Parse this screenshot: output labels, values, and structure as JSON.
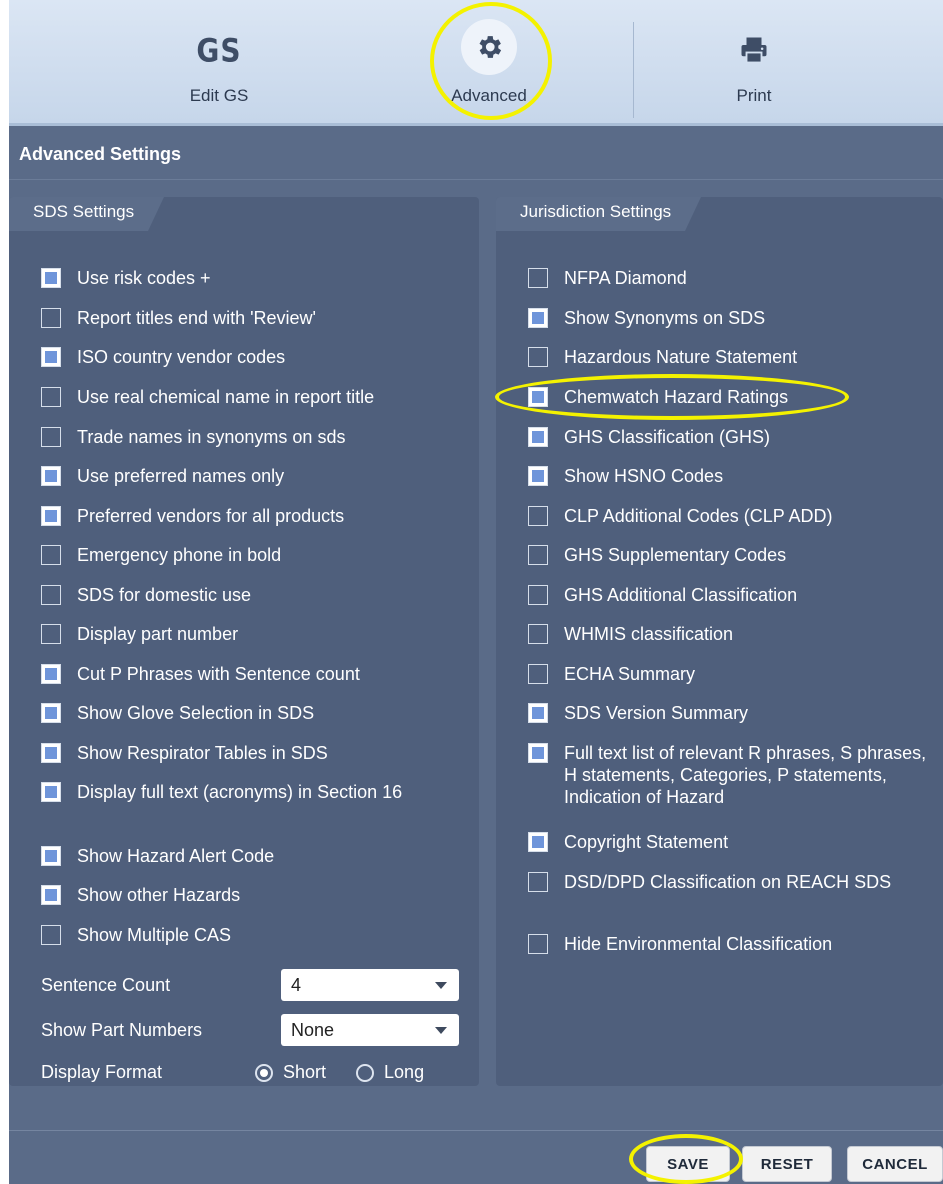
{
  "toolbar": {
    "items": [
      {
        "label": "Edit GS",
        "icon": "gs-logo-icon",
        "logo_text": "GS"
      },
      {
        "label": "Advanced",
        "icon": "gear-icon"
      },
      {
        "label": "Print",
        "icon": "printer-icon"
      }
    ]
  },
  "section_title": "Advanced Settings",
  "sds_settings": {
    "tab_label": "SDS Settings",
    "checkboxes": [
      {
        "label": "Use risk codes +",
        "checked": true
      },
      {
        "label": "Report titles end with 'Review'",
        "checked": false
      },
      {
        "label": "ISO country vendor codes",
        "checked": true
      },
      {
        "label": "Use real chemical name in report title",
        "checked": false
      },
      {
        "label": "Trade names in synonyms on sds",
        "checked": false
      },
      {
        "label": "Use preferred names only",
        "checked": true
      },
      {
        "label": "Preferred vendors for all products",
        "checked": true
      },
      {
        "label": "Emergency phone in bold",
        "checked": false
      },
      {
        "label": "SDS for domestic use",
        "checked": false
      },
      {
        "label": "Display part number",
        "checked": false
      },
      {
        "label": "Cut P Phrases with Sentence count",
        "checked": true
      },
      {
        "label": "Show Glove Selection in SDS",
        "checked": true
      },
      {
        "label": "Show Respirator Tables in SDS",
        "checked": true
      },
      {
        "label": "Display full text (acronyms) in Section 16",
        "checked": true
      },
      {
        "label": "Show Hazard Alert Code",
        "checked": true
      },
      {
        "label": "Show other Hazards",
        "checked": true
      },
      {
        "label": "Show Multiple CAS",
        "checked": false
      }
    ],
    "sentence_count": {
      "label": "Sentence Count",
      "value": "4"
    },
    "show_part_numbers": {
      "label": "Show Part Numbers",
      "value": "None"
    },
    "display_format": {
      "label": "Display Format",
      "options": [
        "Short",
        "Long"
      ],
      "selected": "Short"
    }
  },
  "jurisdiction_settings": {
    "tab_label": "Jurisdiction Settings",
    "checkboxes": [
      {
        "label": "NFPA Diamond",
        "checked": false
      },
      {
        "label": "Show Synonyms on SDS",
        "checked": true
      },
      {
        "label": "Hazardous Nature Statement",
        "checked": false
      },
      {
        "label": "Chemwatch Hazard Ratings",
        "checked": true
      },
      {
        "label": "GHS Classification (GHS)",
        "checked": true
      },
      {
        "label": "Show HSNO Codes",
        "checked": true
      },
      {
        "label": "CLP Additional Codes (CLP ADD)",
        "checked": false
      },
      {
        "label": "GHS Supplementary Codes",
        "checked": false
      },
      {
        "label": "GHS Additional Classification",
        "checked": false
      },
      {
        "label": "WHMIS classification",
        "checked": false
      },
      {
        "label": "ECHA Summary",
        "checked": false
      },
      {
        "label": "SDS Version Summary",
        "checked": true
      },
      {
        "label": "Full text list of relevant R phrases, S phrases, H statements, Categories, P statements, Indication of Hazard",
        "checked": true
      },
      {
        "label": "Copyright Statement",
        "checked": true
      },
      {
        "label": "DSD/DPD Classification on REACH SDS",
        "checked": false
      },
      {
        "label": "Hide Environmental Classification",
        "checked": false
      }
    ]
  },
  "buttons": {
    "save": "SAVE",
    "reset": "RESET",
    "cancel": "CANCEL"
  },
  "colors": {
    "background": "#5a6b88",
    "panel": "#4f5f7c",
    "toolbar": "#d3e0f0",
    "highlight": "#f4f200",
    "checkbox_fill": "#6f95da"
  }
}
